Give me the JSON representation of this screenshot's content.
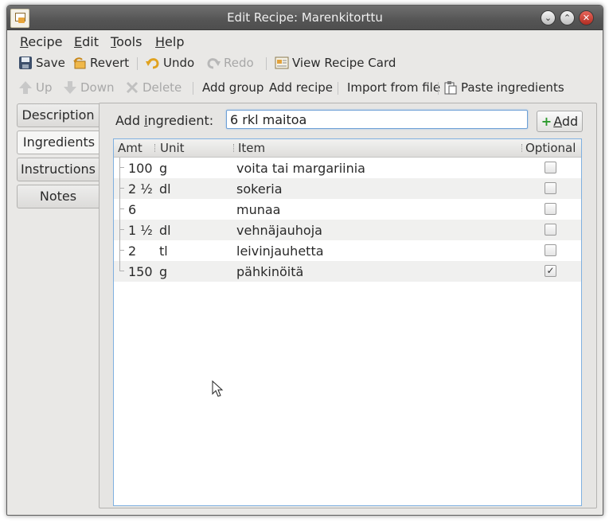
{
  "window": {
    "title": "Edit Recipe: Marenkitorttu"
  },
  "window_buttons": {
    "minimize": "⌄",
    "maximize": "⌃",
    "close": "✕"
  },
  "menubar": [
    {
      "label": "Recipe",
      "mnemonic": "R",
      "rest": "ecipe"
    },
    {
      "label": "Edit",
      "mnemonic": "E",
      "rest": "dit"
    },
    {
      "label": "Tools",
      "mnemonic": "T",
      "rest": "ools"
    },
    {
      "label": "Help",
      "mnemonic": "H",
      "rest": "elp"
    }
  ],
  "toolbar1": {
    "save": "Save",
    "revert": "Revert",
    "undo": "Undo",
    "redo": "Redo",
    "view_card": "View Recipe Card"
  },
  "toolbar2": {
    "up": "Up",
    "down": "Down",
    "delete": "Delete",
    "add_group": "Add group",
    "add_recipe": "Add recipe",
    "import": "Import from file",
    "paste": "Paste ingredients"
  },
  "tabs": [
    {
      "label": "Description",
      "active": false
    },
    {
      "label": "Ingredients",
      "active": true
    },
    {
      "label": "Instructions",
      "active": false
    },
    {
      "label": "Notes",
      "active": false
    }
  ],
  "add_ingredient": {
    "label_pre": "Add ",
    "label_mnemonic": "i",
    "label_post": "ngredient:",
    "value": "6 rkl maitoa",
    "button_mnemonic": "A",
    "button_rest": "dd"
  },
  "table": {
    "columns": {
      "amt": "Amt",
      "unit": "Unit",
      "item": "Item",
      "optional": "Optional"
    },
    "rows": [
      {
        "amt": "100",
        "unit": "g",
        "item": "voita tai margariinia",
        "optional": false
      },
      {
        "amt": "2 ½",
        "unit": "dl",
        "item": "sokeria",
        "optional": false
      },
      {
        "amt": "6",
        "unit": "",
        "item": "munaa",
        "optional": false
      },
      {
        "amt": "1 ½",
        "unit": "dl",
        "item": "vehnäjauhoja",
        "optional": false
      },
      {
        "amt": "2",
        "unit": "tl",
        "item": "leivinjauhetta",
        "optional": false
      },
      {
        "amt": "150",
        "unit": "g",
        "item": "pähkinöitä",
        "optional": true
      }
    ]
  },
  "colors": {
    "accent": "#6ea0d6",
    "titlebar": "#555555",
    "add_icon": "#2c9a2c"
  }
}
